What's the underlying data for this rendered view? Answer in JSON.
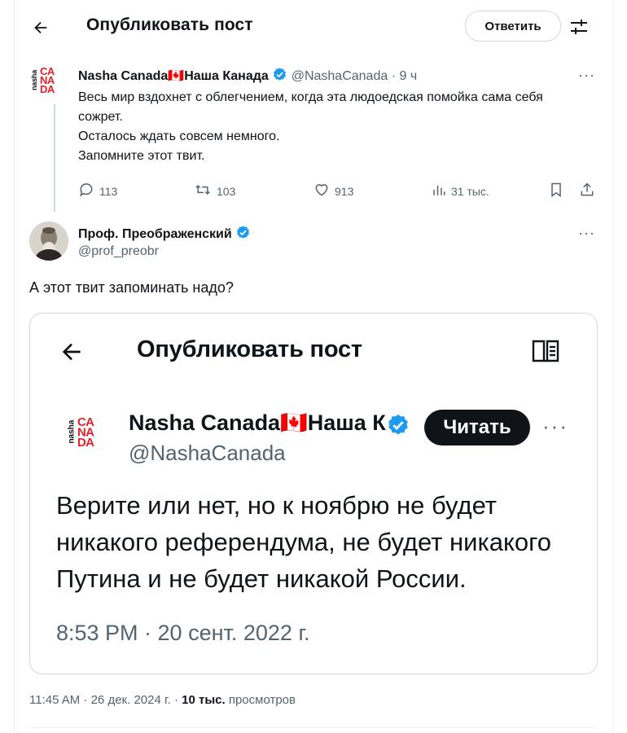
{
  "header": {
    "title": "Опубликовать пост",
    "reply_button": "Ответить"
  },
  "tweet1": {
    "display_name": "Nasha Canada",
    "flag": "🇨🇦",
    "display_name_ru": "Наша Канада",
    "handle": "@NashaCanada",
    "time": "· 9 ч",
    "logo": {
      "nasha": "nasha",
      "ca": "CA",
      "na": "NA",
      "da": "DA"
    },
    "lines": [
      "Весь мир вздохнет с облегчением, когда эта людоедская помойка сама себя сожрет.",
      "Осталось ждать совсем немного.",
      "Запомните этот твит."
    ],
    "stats": {
      "replies": "113",
      "reposts": "103",
      "likes": "913",
      "views": "31 тыс."
    }
  },
  "tweet2": {
    "display_name": "Проф. Преображенский",
    "handle": "@prof_preobr",
    "text": "А этот твит запоминать надо?",
    "meta_time": "11:45 AM · 26 дек. 2024 г. ·",
    "meta_views": "10 тыс.",
    "meta_views_label": "просмотров"
  },
  "card": {
    "title": "Опубликовать пост",
    "display_name": "Nasha Canada",
    "flag": "🇨🇦",
    "display_name_ru_trunc": "Наша К",
    "handle": "@NashaCanada",
    "read_button": "Читать",
    "lines": [
      "Верите или нет, но к ноябрю не будет",
      "никакого референдума, не будет никакого",
      "Путина и не будет никакой России."
    ],
    "timestamp": "8:53 PM · 20 сент. 2022 г."
  },
  "colors": {
    "accent": "#1d9bf0",
    "text": "#0f1419",
    "secondary": "#536471",
    "logo_red": "#e0232a"
  }
}
